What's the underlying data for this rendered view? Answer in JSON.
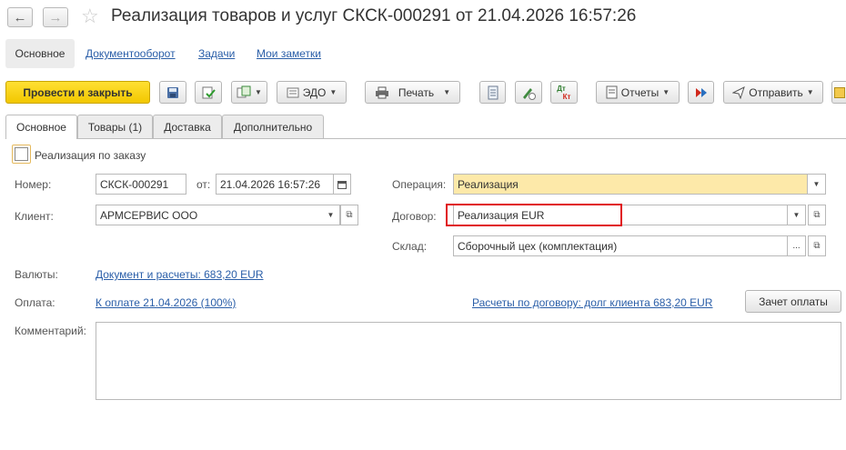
{
  "window": {
    "title": "Реализация товаров и услуг СКСК-000291 от 21.04.2026 16:57:26"
  },
  "sections": {
    "current": "Основное",
    "links": [
      "Документооборот",
      "Задачи",
      "Мои заметки"
    ]
  },
  "toolbar": {
    "post_close": "Провести и закрыть",
    "edo": "ЭДО",
    "print": "Печать",
    "reports": "Отчеты",
    "send": "Отправить",
    "dtkt_top": "Дт",
    "dtkt_bottom": "Кт"
  },
  "tabs": [
    "Основное",
    "Товары (1)",
    "Доставка",
    "Дополнительно"
  ],
  "form": {
    "by_order_label": "Реализация по заказу",
    "number_label": "Номер:",
    "number_value": "СКСК-000291",
    "date_label": "от:",
    "date_value": "21.04.2026 16:57:26",
    "client_label": "Клиент:",
    "client_value": "АРМСЕРВИС ООО",
    "operation_label": "Операция:",
    "operation_value": "Реализация",
    "contract_label": "Договор:",
    "contract_value": "Реализация EUR",
    "warehouse_label": "Склад:",
    "warehouse_value": "Сборочный цех (комплектация)",
    "currency_label": "Валюты:",
    "currency_link": "Документ и расчеты: 683,20 EUR",
    "payment_label": "Оплата:",
    "payment_link": "К оплате 21.04.2026 (100%)",
    "settlements_link": "Расчеты по договору: долг клиента 683,20 EUR",
    "offset_button": "Зачет оплаты",
    "comment_label": "Комментарий:",
    "comment_value": ""
  },
  "colors": {
    "primary_button": "#f2c700",
    "operation_field": "#fde9a9",
    "highlight_border": "#e0141b",
    "link": "#2a5ea8"
  }
}
